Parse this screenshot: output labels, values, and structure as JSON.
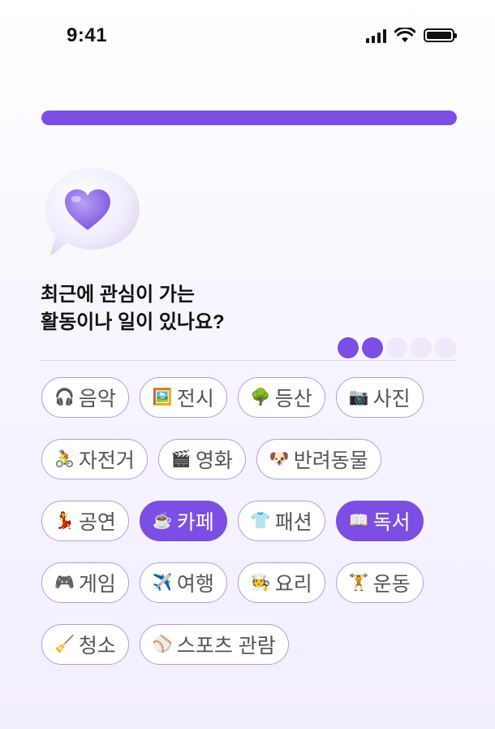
{
  "status_bar": {
    "time": "9:41"
  },
  "progress": {
    "fraction": 1.0
  },
  "question": {
    "line1": "최근에 관심이 가는",
    "line2": "활동이나 일이 있나요?"
  },
  "step_dots": {
    "total": 5,
    "filled": 2
  },
  "colors": {
    "accent": "#7c4ee4",
    "chip_border": "#b39be8",
    "dot_inactive": "#efe9fb"
  },
  "chips": [
    [
      {
        "icon": "headphones-icon",
        "emoji": "🎧",
        "label": "음악",
        "selected": false
      },
      {
        "icon": "framed-picture-icon",
        "emoji": "🖼️",
        "label": "전시",
        "selected": false
      },
      {
        "icon": "tree-icon",
        "emoji": "🌳",
        "label": "등산",
        "selected": false
      },
      {
        "icon": "camera-icon",
        "emoji": "📷",
        "label": "사진",
        "selected": false
      }
    ],
    [
      {
        "icon": "cyclist-icon",
        "emoji": "🚴",
        "label": "자전거",
        "selected": false
      },
      {
        "icon": "clapper-board-icon",
        "emoji": "🎬",
        "label": "영화",
        "selected": false
      },
      {
        "icon": "dog-icon",
        "emoji": "🐶",
        "label": "반려동물",
        "selected": false
      }
    ],
    [
      {
        "icon": "dancer-icon",
        "emoji": "💃",
        "label": "공연",
        "selected": false
      },
      {
        "icon": "coffee-icon",
        "emoji": "☕",
        "label": "카페",
        "selected": true
      },
      {
        "icon": "tshirt-icon",
        "emoji": "👕",
        "label": "패션",
        "selected": false
      },
      {
        "icon": "open-book-icon",
        "emoji": "📖",
        "label": "독서",
        "selected": true
      }
    ],
    [
      {
        "icon": "game-controller-icon",
        "emoji": "🎮",
        "label": "게임",
        "selected": false
      },
      {
        "icon": "airplane-icon",
        "emoji": "✈️",
        "label": "여행",
        "selected": false
      },
      {
        "icon": "cook-icon",
        "emoji": "🧑‍🍳",
        "label": "요리",
        "selected": false
      },
      {
        "icon": "weightlifter-icon",
        "emoji": "🏋️",
        "label": "운동",
        "selected": false
      }
    ],
    [
      {
        "icon": "broom-icon",
        "emoji": "🧹",
        "label": "청소",
        "selected": false
      },
      {
        "icon": "baseball-icon",
        "emoji": "⚾",
        "label": "스포츠 관람",
        "selected": false
      }
    ]
  ]
}
